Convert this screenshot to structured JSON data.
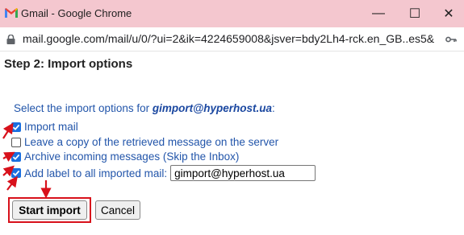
{
  "window": {
    "title": "Gmail - Google Chrome",
    "minimize_glyph": "—",
    "maximize_glyph": "☐",
    "close_glyph": "✕",
    "icon": "gmail-logo-icon"
  },
  "addressbar": {
    "url": "mail.google.com/mail/u/0/?ui=2&ik=4224659008&jsver=bdy2Lh4-rck.en_GB..es5&...",
    "lock_icon": "lock-icon",
    "key_icon": "key-icon"
  },
  "page": {
    "heading": "Step 2: Import options",
    "instruction_prefix": "Select the import options for ",
    "account": "gimport@hyperhost.ua",
    "instruction_suffix": ":"
  },
  "options": [
    {
      "label": "Import mail",
      "checked": true
    },
    {
      "label": "Leave a copy of the retrieved message on the server",
      "checked": false
    },
    {
      "label": "Archive incoming messages (Skip the Inbox)",
      "checked": true
    },
    {
      "label": "Add label to all imported mail:",
      "checked": true
    }
  ],
  "label_field": {
    "value": "gimport@hyperhost.ua"
  },
  "buttons": {
    "start": "Start import",
    "cancel": "Cancel"
  },
  "colors": {
    "titlebar": "#f4c7cf",
    "link_text": "#2255aa",
    "annotation_red": "#d8111b",
    "checkbox_blue": "#1a6fe0"
  }
}
